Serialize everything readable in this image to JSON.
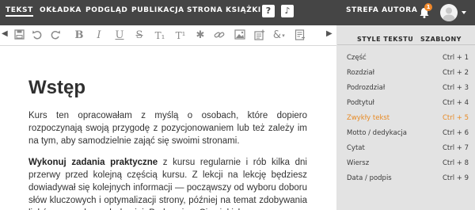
{
  "topbar": {
    "nav": [
      "TEKST",
      "OKŁADKA",
      "PODGLĄD",
      "PUBLIKACJA",
      "STRONA KSIĄŻKI"
    ],
    "help_icon": "question-icon",
    "music_icon": "note-icon",
    "author_zone": "STREFA AUTORA",
    "notification_count": "1"
  },
  "toolbar": {
    "icons": [
      "save-icon",
      "undo-icon",
      "redo-icon",
      "bold-icon",
      "italic-icon",
      "underline-icon",
      "strikethrough-icon",
      "subscript-icon",
      "superscript-icon",
      "special-char-icon",
      "link-icon",
      "image-icon",
      "insert-icon",
      "ampersand-icon",
      "notes-icon"
    ],
    "bold": "B",
    "italic": "I",
    "underline": "U",
    "strike": "S",
    "sub": "T₁",
    "sup": "T¹",
    "star": "✱",
    "amp": "&"
  },
  "document": {
    "title": "Wstęp",
    "p1": "Kurs ten opracowałam z myślą o osobach, które dopiero rozpoczynają swoją przygodę z pozycjonowaniem lub też zależy im na tym, aby samodzielnie zająć się swoimi stronami.",
    "p2_bold": "Wykonuj zadania praktyczne",
    "p2_rest": " z kursu regularnie i rób kilka dni przerwy przed kolejną częścią kursu. Z lekcji na lekcję będziesz dowiadywał się kolejnych informacji — począwszy od wyboru doboru słów kluczowych i optymalizacji strony, później na temat zdobywania linków prowadzących do niej. Podnowiem Ci, z jakich"
  },
  "panel": {
    "tabs": [
      "STYLE TEKSTU",
      "SZABLONY"
    ],
    "styles": [
      {
        "label": "Część",
        "shortcut": "Ctrl + 1"
      },
      {
        "label": "Rozdział",
        "shortcut": "Ctrl + 2"
      },
      {
        "label": "Podrozdział",
        "shortcut": "Ctrl + 3"
      },
      {
        "label": "Podtytuł",
        "shortcut": "Ctrl + 4"
      },
      {
        "label": "Zwykły tekst",
        "shortcut": "Ctrl + 5"
      },
      {
        "label": "Motto / dedykacja",
        "shortcut": "Ctrl + 6"
      },
      {
        "label": "Cytat",
        "shortcut": "Ctrl + 7"
      },
      {
        "label": "Wiersz",
        "shortcut": "Ctrl + 8"
      },
      {
        "label": "Data / podpis",
        "shortcut": "Ctrl + 9"
      }
    ],
    "active_style": "Zwykły tekst",
    "active_color": "#e88a24"
  },
  "colors": {
    "topbar": "#454545",
    "panel": "#e3e3e3",
    "accent": "#f0882a"
  }
}
